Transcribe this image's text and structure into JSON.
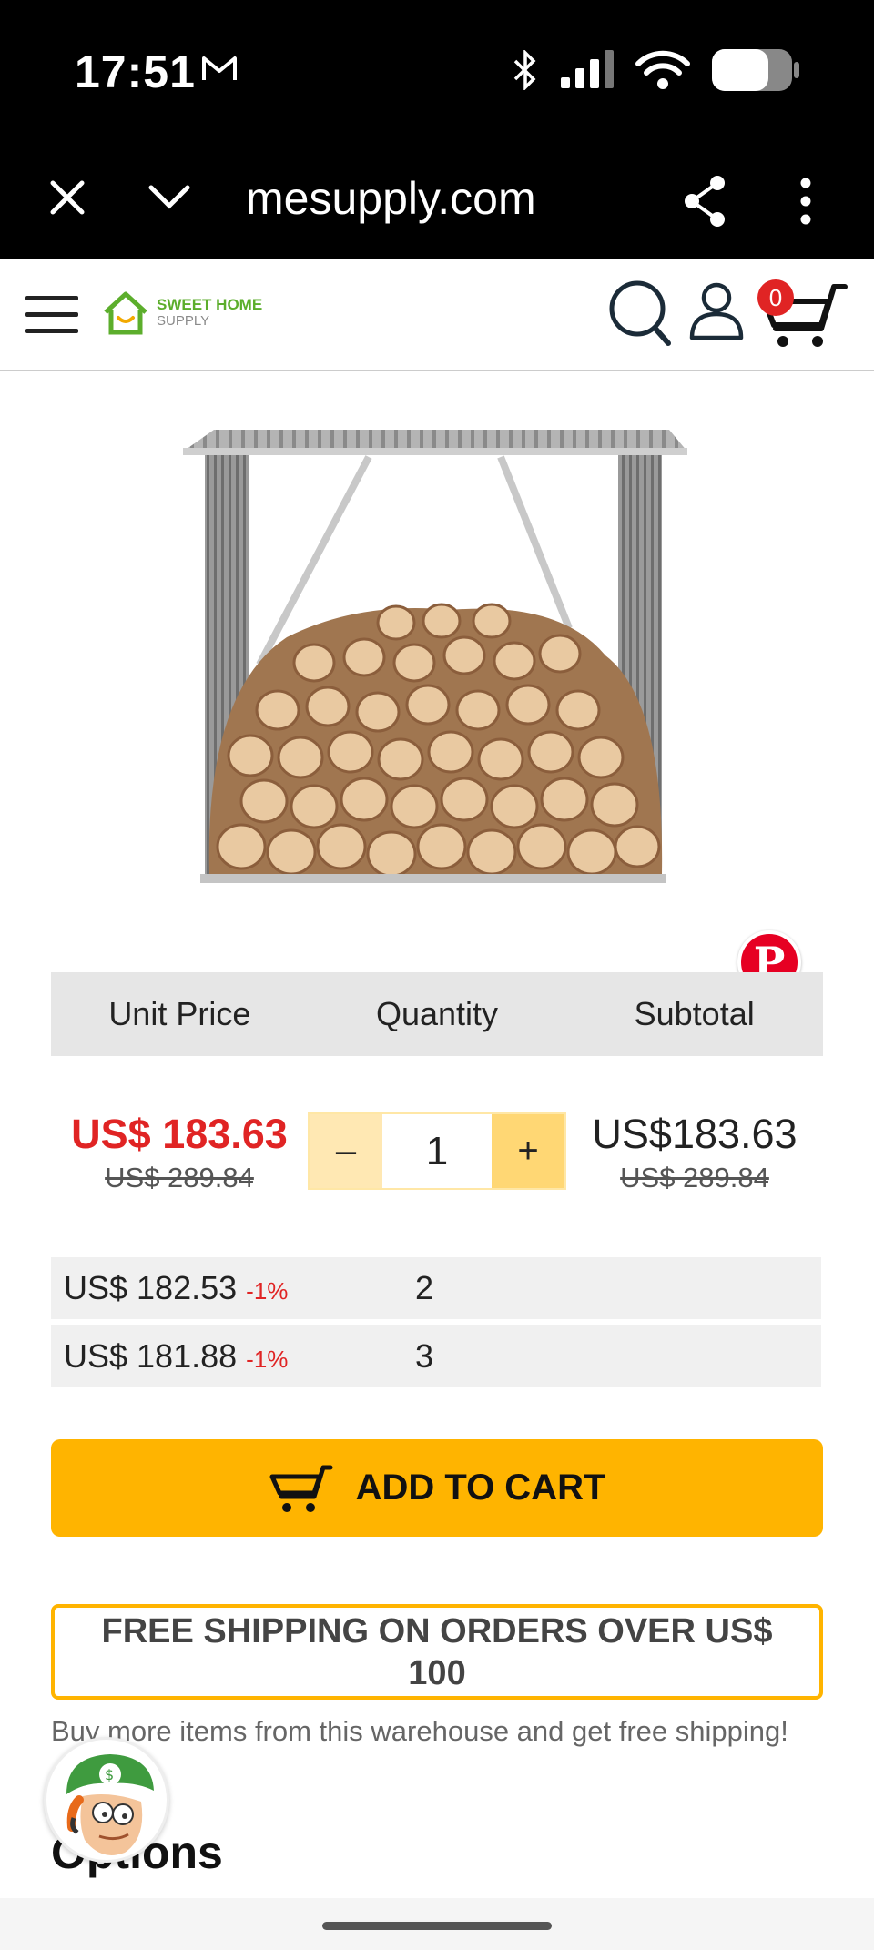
{
  "status_bar": {
    "time": "17:51"
  },
  "browser": {
    "url": "mesupply.com"
  },
  "header": {
    "logo_line1": "SWEET HOME",
    "logo_line2": "SUPPLY",
    "cart_count": "0"
  },
  "price_table": {
    "headers": [
      "Unit Price",
      "Quantity",
      "Subtotal"
    ],
    "unit_price": "US$ 183.63",
    "unit_price_original": "US$ 289.84",
    "quantity": "1",
    "minus_label": "–",
    "plus_label": "+",
    "subtotal": "US$183.63",
    "subtotal_original": "US$ 289.84"
  },
  "tiers": [
    {
      "price": "US$ 182.53",
      "discount": "-1%",
      "qty": "2"
    },
    {
      "price": "US$ 181.88",
      "discount": "-1%",
      "qty": "3"
    }
  ],
  "add_to_cart_label": "ADD TO CART",
  "free_shipping": "FREE SHIPPING ON ORDERS OVER US$ 100",
  "shipping_note": "Buy more items from this warehouse and get free shipping!",
  "options_heading": "Options",
  "colors": {
    "accent": "#ffb400",
    "sale_red": "#e02424",
    "brand_green": "#5cae2c",
    "pinterest": "#e60023"
  }
}
